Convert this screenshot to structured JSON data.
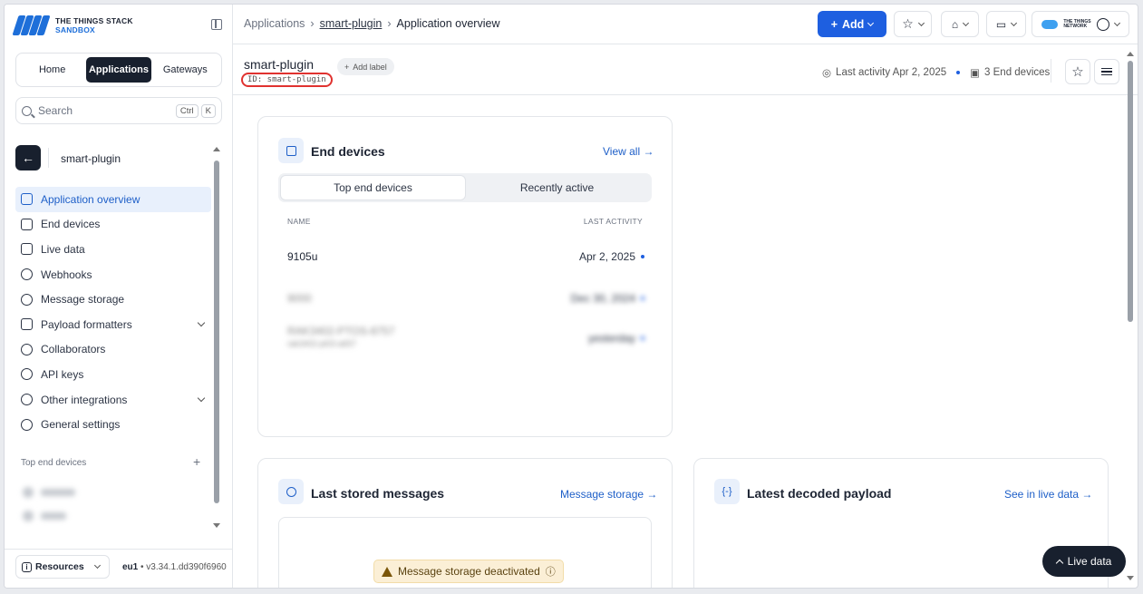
{
  "logo": {
    "line1": "THE THINGS STACK",
    "line2": "SANDBOX"
  },
  "navtabs": [
    {
      "label": "Home"
    },
    {
      "label": "Applications"
    },
    {
      "label": "Gateways"
    }
  ],
  "search": {
    "placeholder": "Search",
    "kbd1": "Ctrl",
    "kbd2": "K"
  },
  "app": {
    "name": "smart-plugin"
  },
  "menu": [
    {
      "label": "Application overview"
    },
    {
      "label": "End devices"
    },
    {
      "label": "Live data"
    },
    {
      "label": "Webhooks"
    },
    {
      "label": "Message storage"
    },
    {
      "label": "Payload formatters"
    },
    {
      "label": "Collaborators"
    },
    {
      "label": "API keys"
    },
    {
      "label": "Other integrations"
    },
    {
      "label": "General settings"
    }
  ],
  "sidebar_section": {
    "top_devices": "Top end devices"
  },
  "footer": {
    "resources": "Resources",
    "region": "eu1",
    "version": " • v3.34.1.dd390f6960"
  },
  "breadcrumb": {
    "applications": "Applications",
    "app": "smart-plugin",
    "current": "Application overview"
  },
  "header": {
    "add_label": "Add",
    "ttn_line1": "THE THINGS",
    "ttn_line2": "NETWORK"
  },
  "page": {
    "title": "smart-plugin",
    "add_label": "Add label",
    "id": "ID: smart-plugin",
    "last_activity": "Last activity Apr 2, 2025",
    "end_device_count": "3 End devices"
  },
  "end_devices_card": {
    "title": "End devices",
    "view_all": "View all →",
    "tab_top": "Top end devices",
    "tab_recent": "Recently active",
    "col_name": "NAME",
    "col_activity": "LAST ACTIVITY",
    "rows": [
      {
        "name": "9105u",
        "last": "Apr 2, 2025"
      },
      {
        "name": "9000",
        "last": "Dec 30, 2024"
      },
      {
        "name": "RAK3402-PTOS-8757",
        "sub": "rak3402-pt03-a657",
        "last": "yesterday"
      }
    ]
  },
  "messages_card": {
    "title": "Last stored messages",
    "link": "Message storage →",
    "warning": "Message storage deactivated"
  },
  "payload_card": {
    "title": "Latest decoded payload",
    "link": "See in live data →"
  },
  "live_button": "Live data",
  "colors": {
    "accent": "#1e5fe0",
    "dark": "#18202e",
    "warning_bg": "#fbefd6",
    "id_outline": "#e0322f"
  }
}
